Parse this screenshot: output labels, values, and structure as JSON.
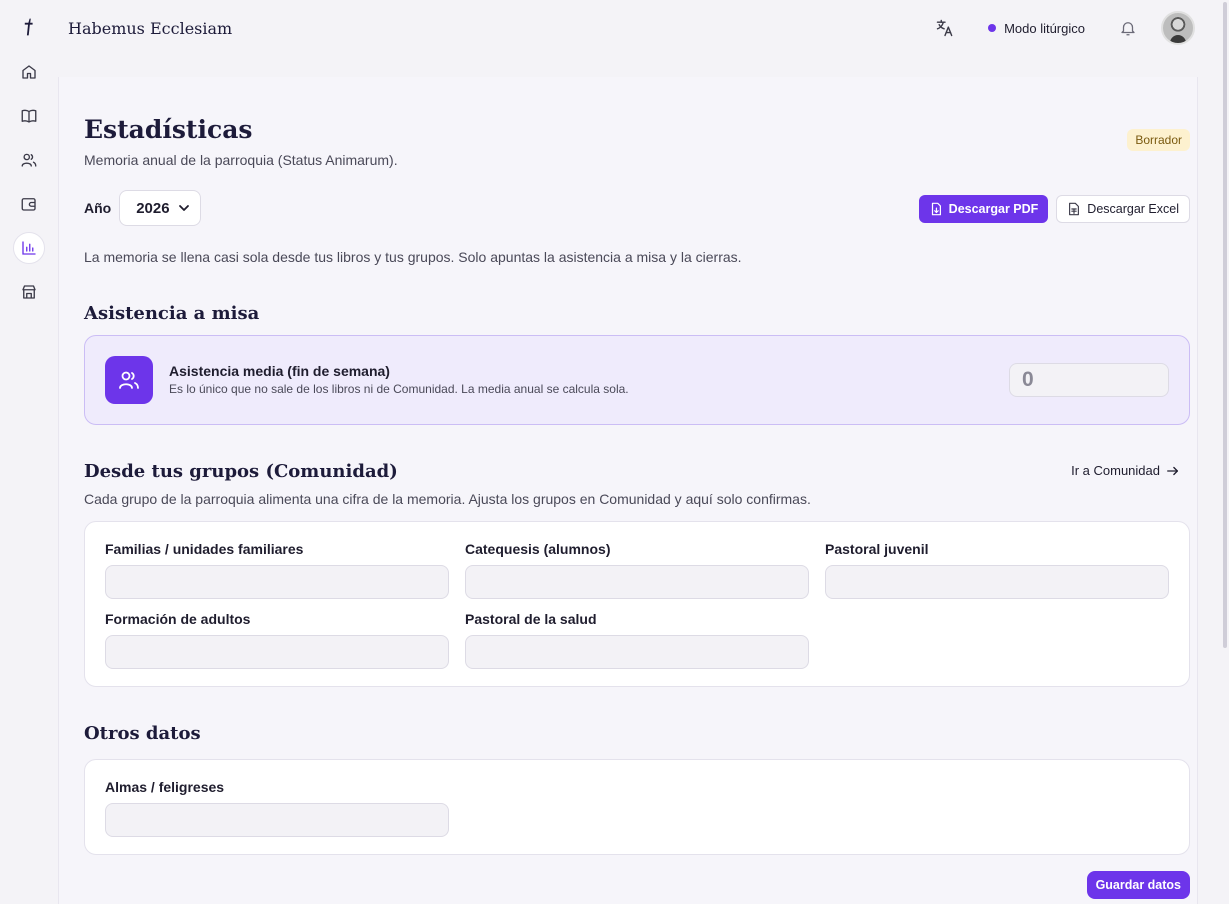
{
  "app": {
    "brand": "Habemus Ecclesiam"
  },
  "topbar": {
    "liturgical_mode": "Modo litúrgico"
  },
  "sidebar": {
    "items": [
      {
        "icon": "home-icon"
      },
      {
        "icon": "book-icon"
      },
      {
        "icon": "users-icon"
      },
      {
        "icon": "wallet-icon"
      },
      {
        "icon": "bar-chart-icon",
        "active": true
      },
      {
        "icon": "store-icon"
      }
    ]
  },
  "page": {
    "title": "Estadísticas",
    "subtitle": "Memoria anual de la parroquia (Status Animarum).",
    "status_badge": "Borrador",
    "year_label": "Año",
    "year_value": "2026",
    "download_pdf": "Descargar PDF",
    "download_excel": "Descargar Excel",
    "intro": "La memoria se llena casi sola desde tus libros y tus grupos. Solo apuntas la asistencia a misa y la cierras."
  },
  "mass": {
    "section_title": "Asistencia a misa",
    "card_title": "Asistencia media (fin de semana)",
    "card_desc": "Es lo único que no sale de los libros ni de Comunidad. La media anual se calcula sola.",
    "value": "0"
  },
  "groups": {
    "section_title": "Desde tus grupos (Comunidad)",
    "link": "Ir a Comunidad",
    "subtitle": "Cada grupo de la parroquia alimenta una cifra de la memoria. Ajusta los grupos en Comunidad y aquí solo confirmas.",
    "fields": [
      {
        "label": "Familias / unidades familiares"
      },
      {
        "label": "Catequesis (alumnos)"
      },
      {
        "label": "Pastoral juvenil"
      },
      {
        "label": "Formación de adultos"
      },
      {
        "label": "Pastoral de la salud"
      }
    ]
  },
  "other": {
    "section_title": "Otros datos",
    "fields": [
      {
        "label": "Almas / feligreses"
      }
    ]
  },
  "footer": {
    "save_label": "Guardar datos"
  },
  "colors": {
    "accent": "#6d35ea",
    "badge_bg": "#fdf1cf",
    "badge_text": "#7a5a10",
    "card_highlight": "#efebfc"
  }
}
